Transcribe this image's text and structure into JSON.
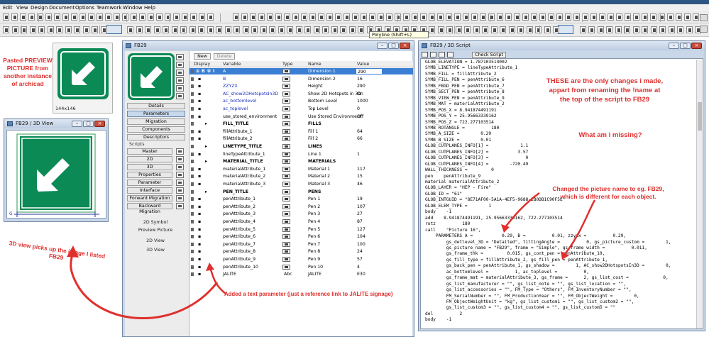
{
  "app": {
    "menus": [
      "Edit",
      "View",
      "Design",
      "Document",
      "Options",
      "Teamwork",
      "Window",
      "Help"
    ],
    "tooltip": "Polyline (Shift+L)"
  },
  "preview": {
    "size_label": "144x146"
  },
  "view3d": {
    "title": "FB29 / 3D View",
    "axis_label": "G"
  },
  "fb29": {
    "title": "FB29",
    "toolbar": {
      "new": "New",
      "delete": "Delete"
    },
    "columns": {
      "display": "Display",
      "variable": "Variable",
      "type": "Type",
      "name": "Name",
      "value": "Value"
    },
    "rows": [
      {
        "var": "A",
        "name": "Dimension 1",
        "value": "290",
        "link": true,
        "hl": true
      },
      {
        "var": "B",
        "name": "Dimension 2",
        "value": "16",
        "link": true
      },
      {
        "var": "ZZYZX",
        "name": "Height",
        "value": "290",
        "link": true
      },
      {
        "var": "AC_show2DHotspotsIn3D",
        "name": "Show 2D Hotspots in 3D",
        "value": "On",
        "link": true
      },
      {
        "var": "ac_bottomlevel",
        "name": "Bottom Level",
        "value": "1000",
        "link": true
      },
      {
        "var": "ac_toplevel",
        "name": "Top Level",
        "value": "0",
        "link": true
      },
      {
        "var": "use_stored_environment",
        "name": "Use Stored Environment",
        "value": "Off"
      },
      {
        "var": "FILL_TITLE",
        "name": "FILLS",
        "value": "",
        "bold": true
      },
      {
        "var": "fillAttribute_1",
        "name": "Fill 1",
        "value": "64"
      },
      {
        "var": "fillAttribute_2",
        "name": "Fill 2",
        "value": "66"
      },
      {
        "var": "LINETYPE_TITLE",
        "name": "LINES",
        "value": "",
        "bold": true
      },
      {
        "var": "lineTypeAttribute_1",
        "name": "Line 1",
        "value": "1"
      },
      {
        "var": "MATERIAL_TITLE",
        "name": "MATERIALS",
        "value": "",
        "bold": true
      },
      {
        "var": "materialAttribute_1",
        "name": "Material 1",
        "value": "117"
      },
      {
        "var": "materialAttribute_2",
        "name": "Material 2",
        "value": "15"
      },
      {
        "var": "materialAttribute_3",
        "name": "Material 3",
        "value": "46"
      },
      {
        "var": "PEN_TITLE",
        "name": "PENS",
        "value": "",
        "bold": true
      },
      {
        "var": "penAttribute_1",
        "name": "Pen 1",
        "value": "19"
      },
      {
        "var": "penAttribute_2",
        "name": "Pen 2",
        "value": "107"
      },
      {
        "var": "penAttribute_3",
        "name": "Pen 3",
        "value": "27"
      },
      {
        "var": "penAttribute_4",
        "name": "Pen 4",
        "value": "87"
      },
      {
        "var": "penAttribute_5",
        "name": "Pen 5",
        "value": "127"
      },
      {
        "var": "penAttribute_6",
        "name": "Pen 6",
        "value": "104"
      },
      {
        "var": "penAttribute_7",
        "name": "Pen 7",
        "value": "100"
      },
      {
        "var": "penAttribute_8",
        "name": "Pen 8",
        "value": "24"
      },
      {
        "var": "penAttribute_9",
        "name": "Pen 9",
        "value": "57"
      },
      {
        "var": "penAttribute_10",
        "name": "Pen 10",
        "value": "4"
      },
      {
        "var": "JALITE",
        "name": "JALITE",
        "value": "E30",
        "type_text": "Abc"
      }
    ],
    "side": {
      "details": "Details",
      "parameters": "Parameters",
      "migration": "Migration",
      "components": "Components",
      "descriptors": "Descriptors",
      "scripts_label": "Scripts",
      "scripts": [
        "Master",
        "2D",
        "3D",
        "Properties",
        "Parameter",
        "Interface",
        "Forward Migration",
        "Backward Migration"
      ],
      "symbol_2d": "2D Symbol",
      "preview_picture": "Preview Picture",
      "view_2d": "2D View",
      "view_3d": "3D View"
    }
  },
  "script": {
    "title": "FB29 / 3D Script",
    "check_button": "Check Script",
    "lines": [
      "GLOB_ELEVATION = 1.787103514002",
      "SYMB_LINETYPE = lineTypeAttribute_1",
      "SYMB_FILL = fillAttribute_2",
      "SYMB_FILL_PEN = penAttribute_6",
      "SYMB_FBGD_PEN = penAttribute_7",
      "SYMB_SECT_PEN = penAttribute_8",
      "SYMB_VIEW_PEN = penAttribute_9",
      "SYMB_MAT = materialAttribute_2",
      "SYMB_POS_X = 8.941874491191",
      "SYMB_POS_Y = 25.95663339162",
      "SYMB_POS_Z = 722.277103514",
      "SYMB_ROTANGLE =          180",
      "SYMB_A_SIZE =        0.29",
      "SYMB_B_SIZE =        0.01",
      "GLOB_CUTPLANES_INFO[1] =            1.1",
      "GLOB_CUTPLANES_INFO[2] =           3.57",
      "GLOB_CUTPLANES_INFO[3] =              0",
      "GLOB_CUTPLANES_INFO[4] =        -720.49",
      "WALL_THICKNESS =         0",
      "pen    penAttribute_9",
      "material materialAttribute_2",
      "GLOB_LAYER = \"HEP - Fire\"",
      "GLOB_ID = \"61\"",
      "GLOB_INTGUID = \"8E71AF00-5A1A-4EF5-9688-2B0DB1C90F5E\"",
      "GLOB_ELEM_TYPE =        1",
      "body    -1",
      "add    8.941874491191, 25.95663339162, 722.277103514",
      "rotz          180",
      "call    \"Picture 16\",",
      "    PARAMETERS A =           0.29, B =          0.01, zzyzx =          0.29,",
      "        gs_detlevel_3D = \"Detailed\", tiltingAngle =          0, gs_picture_custom =        1,",
      "        gs_picture_name = \"FB29\", frame = \"Simple\", gs_frame_width =          0.011,",
      "        gs_frame_thk =         0.015, gs_cont_pen = penAttribute_10,",
      "        gs_fill_type = fillAttribute_2, gs_fill_pen = penAttribute_1,",
      "        gs_back_pen = penAttribute_1, gs_shadow =        1, AC_show2DHotspotsIn3D =        0,",
      "        ac_bottomlevel =          1, ac_toplevel =          0,",
      "        gs_frame_mat = materialAttribute_3, gs_frame =      2, gs_list_cost =             0,",
      "        gs_list_manufacturer = \"\", gs_list_note = \"\", gs_list_location = \"\",",
      "        gs_list_accessories = \"\", FM_Type = \"Others\", FM_InventoryNumber = \"\",",
      "        FM_SerialNumber = \"\", FM_ProductionYear = \"\", FM_ObjectWeight =        0,",
      "        FM_ObjectWeightUnit = \"kg\", gs_list_custom1 = \"\", gs_list_custom2 = \"\",",
      "        gs_list_custom3 = \"\", gs_list_custom4 = \"\", gs_list_custom5 = \"\"",
      "del          2",
      "body    -1"
    ]
  },
  "annotations": {
    "pasted_preview": [
      "Pasted PREVIEW",
      "PICTURE from",
      "another instance",
      "of archicad"
    ],
    "only_changes": [
      "THESE are the only changes i made,",
      "appart from renaming the !name at",
      "the top of the script to FB29"
    ],
    "missing": "What am i missing?",
    "picture_name": [
      "Changed the picture name to eg. FB29,",
      "which is different for each object."
    ],
    "view3d_note": "3D view picks up the image I listed FB29",
    "text_param": "Added a text parameter (just a reference link to JALITE signage)",
    "color": "#e0302e"
  },
  "colors": {
    "sign_green": "#0b8a56",
    "selection_blue": "#3a7fd3",
    "window_frame": "#c9d7e8"
  }
}
